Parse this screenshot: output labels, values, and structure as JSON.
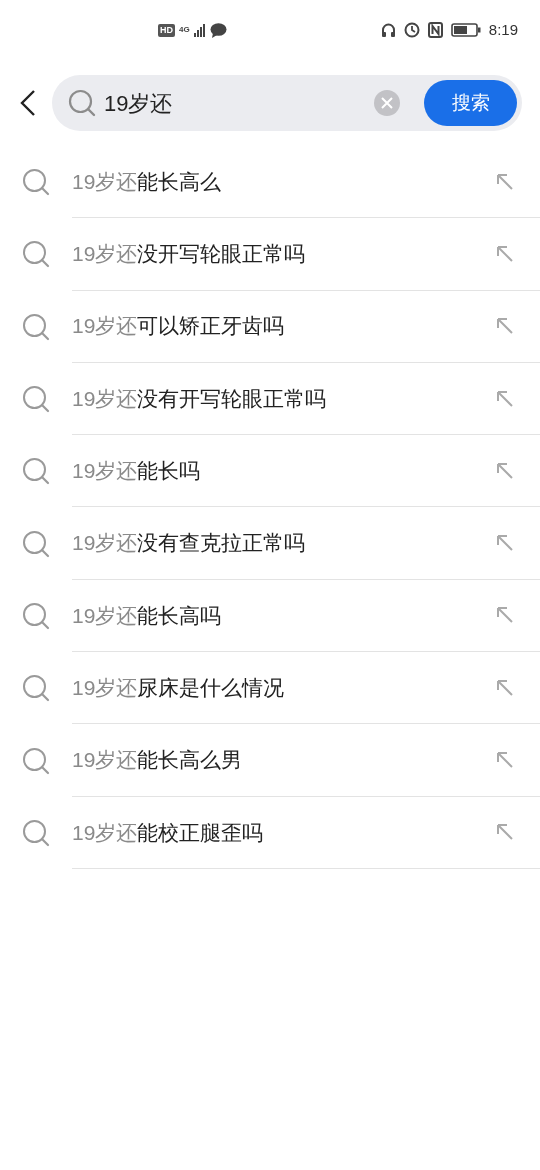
{
  "status_bar": {
    "hd": "HD",
    "network": "4G",
    "time": "8:19"
  },
  "search": {
    "value": "19岁还",
    "button": "搜索"
  },
  "suggestions": [
    {
      "match": "19岁还",
      "rest": "能长高么"
    },
    {
      "match": "19岁还",
      "rest": "没开写轮眼正常吗"
    },
    {
      "match": "19岁还",
      "rest": "可以矫正牙齿吗"
    },
    {
      "match": "19岁还",
      "rest": "没有开写轮眼正常吗"
    },
    {
      "match": "19岁还",
      "rest": "能长吗"
    },
    {
      "match": "19岁还",
      "rest": "没有查克拉正常吗"
    },
    {
      "match": "19岁还",
      "rest": "能长高吗"
    },
    {
      "match": "19岁还",
      "rest": "尿床是什么情况"
    },
    {
      "match": "19岁还",
      "rest": "能长高么男"
    },
    {
      "match": "19岁还",
      "rest": "能校正腿歪吗"
    }
  ]
}
